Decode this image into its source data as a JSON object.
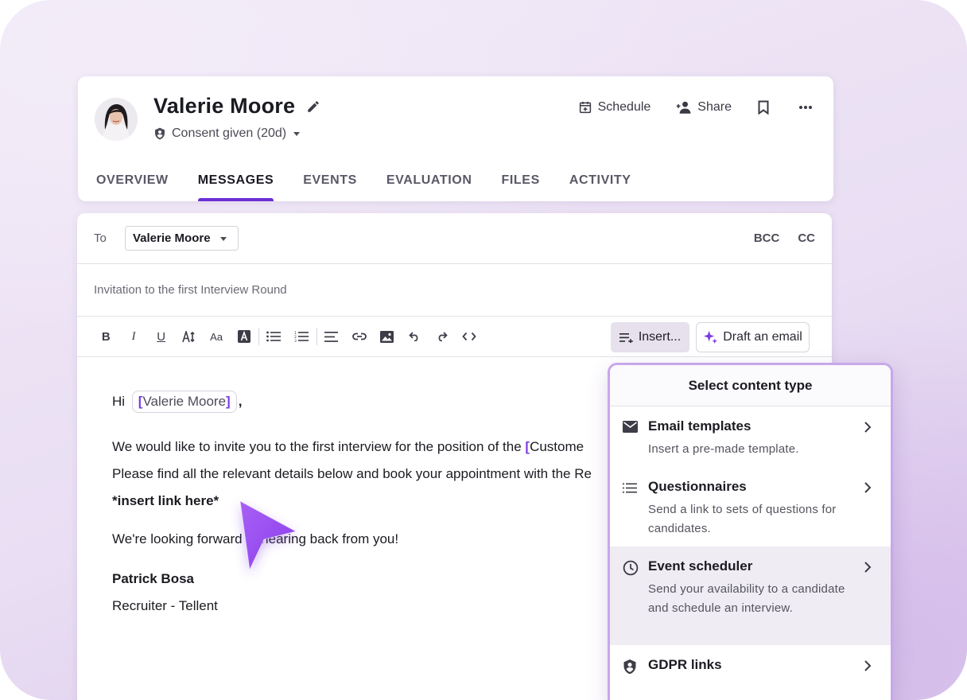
{
  "candidate": {
    "name": "Valerie Moore",
    "consent": "Consent given (20d)"
  },
  "header_actions": {
    "schedule": "Schedule",
    "share": "Share"
  },
  "tabs": [
    {
      "label": "OVERVIEW",
      "active": false
    },
    {
      "label": "MESSAGES",
      "active": true
    },
    {
      "label": "EVENTS",
      "active": false
    },
    {
      "label": "EVALUATION",
      "active": false
    },
    {
      "label": "FILES",
      "active": false
    },
    {
      "label": "ACTIVITY",
      "active": false
    }
  ],
  "compose": {
    "to_label": "To",
    "recipient": "Valerie Moore",
    "bcc": "BCC",
    "cc": "CC",
    "subject": "Invitation to the first Interview Round",
    "insert_label": "Insert...",
    "draft_label": "Draft an email"
  },
  "message": {
    "greeting": "Hi",
    "greeting_merge": "Valerie Moore",
    "greeting_comma": ",",
    "line1_text": "We would like to invite you to the first interview for the position of the ",
    "line1_merge": "Custome",
    "line2": "Please find all the relevant details below and book your appointment with the Re",
    "line3": "*insert link here*",
    "line4": "We're looking forward to hearing back from you!",
    "sig_name": "Patrick Bosa",
    "sig_title": "Recruiter - Tellent"
  },
  "content_panel": {
    "title": "Select content type",
    "options": [
      {
        "icon": "envelope-icon",
        "title": "Email templates",
        "desc": "Insert a pre-made template."
      },
      {
        "icon": "list-icon",
        "title": "Questionnaires",
        "desc": "Send a link to sets of questions for candidates."
      },
      {
        "icon": "clock-icon",
        "title": "Event scheduler",
        "desc": "Send your availability to a candidate and schedule an interview.",
        "highlighted": true
      },
      {
        "icon": "shield-person-icon",
        "title": "GDPR links",
        "desc": ""
      }
    ]
  },
  "colors": {
    "accent": "#6b2fd6",
    "merge_bracket": "#7b3ce0",
    "panel_border": "#c8a7ea",
    "cursor": "#9b4ff0"
  }
}
